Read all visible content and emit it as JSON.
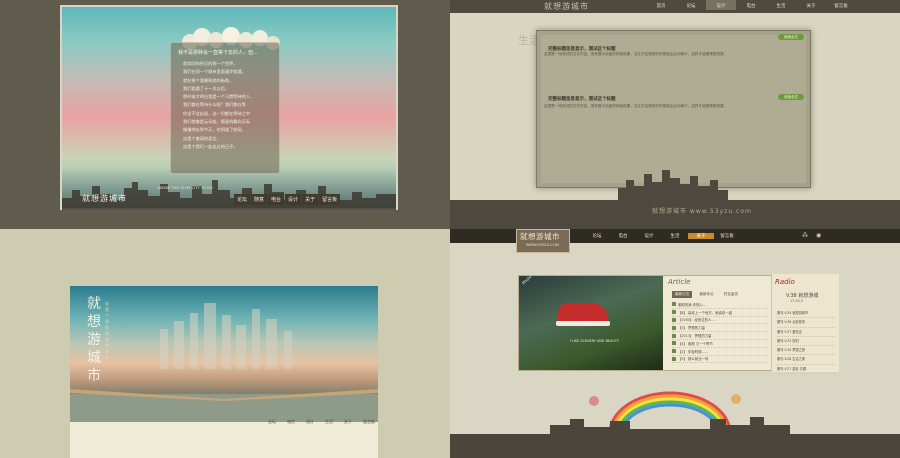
{
  "panel1": {
    "heading": "我不是那种会一直等下去的人，但...",
    "lines": [
      "就如同你所见的那一个世界，",
      "我们在同一个城市里面漫步相遇，",
      "就在那个我最熟悉的街角，",
      "我们相遇了十一次以后，",
      "那时候才明白我是一个习惯等待的人，",
      "我们都在等待什么呢？我们都在等",
      "你会不会出现，这一切都在等待之中",
      "我们就像是云朵般，随意的飘向天际",
      "慢慢地走到今天，也知道了结局，",
      "这是个美丽的谎言，",
      "这是个我们一起走过的日子。"
    ],
    "logo": "就想游城市",
    "subtitle": "MAYBE THIS IS MY CITY TO GO",
    "nav": [
      "论坛",
      "随意",
      "电台",
      "设计",
      "关于",
      "留言板"
    ]
  },
  "panel2": {
    "logo": "就想游城市",
    "nav": [
      {
        "label": "首页",
        "active": false
      },
      {
        "label": "论坛",
        "active": false
      },
      {
        "label": "设计",
        "active": true
      },
      {
        "label": "电台",
        "active": false
      },
      {
        "label": "生活",
        "active": false
      },
      {
        "label": "关于",
        "active": false
      },
      {
        "label": "留言板",
        "active": false
      }
    ],
    "side_text": "生活",
    "post1_title": "完整标题信息显示，测试这个标题",
    "post2_title": "完整标题信息显示，测试这个标题",
    "button": "阅读全文",
    "para": "这里是一段测试的文字内容，用来展示页面的排版效果，当文字足够多的时候就会自动换行，这样才能看清楚效果。",
    "watermark": "就想游城市 www.53yzu.com"
  },
  "panel3": {
    "title": "就想游城市",
    "vertical_sub": "这是个寻找梦想的城市",
    "nav": [
      "论坛",
      "电台",
      "设计",
      "生活",
      "关于",
      "留言板"
    ]
  },
  "panel4": {
    "logo": "就想游城市",
    "logo_url": "WWW.53YZU.COM",
    "nav": [
      {
        "label": "论坛",
        "active": false
      },
      {
        "label": "电台",
        "active": false
      },
      {
        "label": "设计",
        "active": false
      },
      {
        "label": "生活",
        "active": false
      },
      {
        "label": "关于",
        "active": true
      },
      {
        "label": "留言板",
        "active": false
      }
    ],
    "photo_label": "Photo",
    "photo_caption": "I LIKE SCENERY AND BEAUTY",
    "article_heading": "Article",
    "tabs": [
      {
        "label": "最新日志",
        "active": true
      },
      {
        "label": "最新评论",
        "active": false
      },
      {
        "label": "好友留言",
        "active": false
      }
    ],
    "articles": [
      "素颜的我 你的心...",
      "【8】 喜欢上一个地方，就喜欢一起",
      "【1000】 经历过的人...",
      "【5】 梦想的力量",
      "【2013】 梦想的力量",
      "【4】 素颜 又一个季节",
      "【2】 年轻时候......",
      "【5】 那么就当一场"
    ],
    "radio_heading": "Radio",
    "radio_version": "V.38 就想游城",
    "radio_date": "17.03.5",
    "radio_list": [
      "期刊 V.35 就想游城市",
      "期刊 V.36 北京故事",
      "期刊 V.37 爱在这",
      "期刊 V.32 告别",
      "期刊 V.30 梦想之旅",
      "期刊 V.28 生活之美",
      "期刊 V.27 游走 青春"
    ]
  }
}
